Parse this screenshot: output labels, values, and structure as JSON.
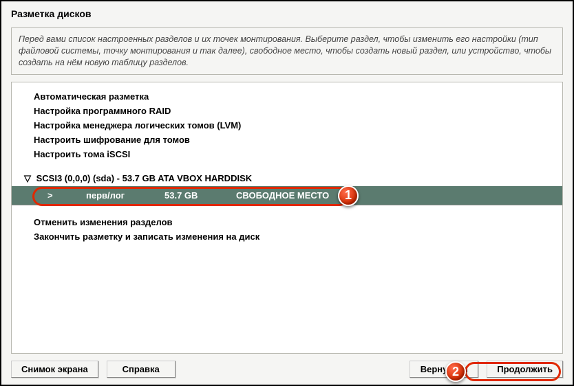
{
  "title": "Разметка дисков",
  "description": "Перед вами список настроенных разделов и их точек монтирования. Выберите раздел, чтобы изменить его настройки (тип файловой системы, точку монтирования и так далее), свободное место, чтобы создать новый раздел, или устройство, чтобы создать на нём новую таблицу разделов.",
  "menu": {
    "auto": "Автоматическая разметка",
    "raid": "Настройка программного RAID",
    "lvm": "Настройка менеджера логических томов (LVM)",
    "encrypt": "Настроить шифрование для томов",
    "iscsi": "Настроить тома iSCSI"
  },
  "disk": {
    "expander": "▽",
    "label": "SCSI3 (0,0,0) (sda) - 53.7 GB ATA VBOX HARDDISK",
    "partition": {
      "chevron": ">",
      "type": "перв/лог",
      "size": "53.7 GB",
      "status": "СВОБОДНОЕ МЕСТО"
    }
  },
  "actions": {
    "undo": "Отменить изменения разделов",
    "finish": "Закончить разметку и записать изменения на диск"
  },
  "buttons": {
    "screenshot": "Снимок экрана",
    "help": "Справка",
    "back": "Вернуться",
    "continue": "Продолжить"
  },
  "badges": {
    "one": "1",
    "two": "2"
  }
}
